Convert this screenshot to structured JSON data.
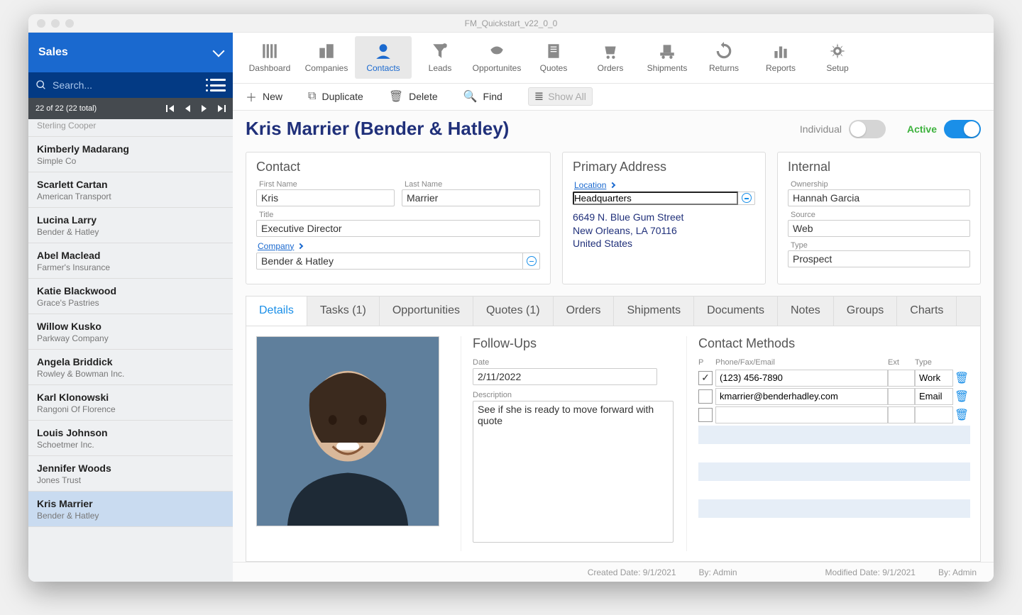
{
  "window": {
    "title": "FM_Quickstart_v22_0_0"
  },
  "sidebar": {
    "module": "Sales",
    "search_placeholder": "Search...",
    "pager": "22 of 22 (22 total)",
    "partial_item": {
      "company": "Sterling Cooper"
    },
    "items": [
      {
        "name": "Kimberly Madarang",
        "company": "Simple Co"
      },
      {
        "name": "Scarlett Cartan",
        "company": "American Transport"
      },
      {
        "name": "Lucina Larry",
        "company": "Bender & Hatley"
      },
      {
        "name": "Abel Maclead",
        "company": "Farmer's Insurance"
      },
      {
        "name": "Katie Blackwood",
        "company": "Grace's Pastries"
      },
      {
        "name": "Willow Kusko",
        "company": "Parkway Company"
      },
      {
        "name": "Angela Briddick",
        "company": "Rowley & Bowman Inc."
      },
      {
        "name": "Karl Klonowski",
        "company": "Rangoni Of Florence"
      },
      {
        "name": "Louis Johnson",
        "company": "Schoetmer Inc."
      },
      {
        "name": "Jennifer Woods",
        "company": "Jones Trust"
      },
      {
        "name": "Kris Marrier",
        "company": "Bender & Hatley"
      }
    ],
    "selected_index": 10
  },
  "toolbar": {
    "items": [
      "Dashboard",
      "Companies",
      "Contacts",
      "Leads",
      "Opportunites",
      "Quotes",
      "Orders",
      "Shipments",
      "Returns",
      "Reports",
      "Setup"
    ],
    "active_index": 2
  },
  "actions": {
    "new": "New",
    "duplicate": "Duplicate",
    "delete": "Delete",
    "find": "Find",
    "show_all": "Show All"
  },
  "record": {
    "title": "Kris Marrier (Bender & Hatley)",
    "individual_label": "Individual",
    "active_label": "Active"
  },
  "contact_panel": {
    "title": "Contact",
    "first_name_label": "First Name",
    "first_name": "Kris",
    "last_name_label": "Last Name",
    "last_name": "Marrier",
    "title_label": "Title",
    "title_value": "Executive Director",
    "company_label": "Company",
    "company": "Bender & Hatley"
  },
  "address_panel": {
    "title": "Primary Address",
    "location_label": "Location",
    "location": "Headquarters",
    "line1": "6649 N. Blue Gum Street",
    "line2": "New Orleans, LA 70116",
    "line3": "United States"
  },
  "internal_panel": {
    "title": "Internal",
    "ownership_label": "Ownership",
    "ownership": "Hannah Garcia",
    "source_label": "Source",
    "source": "Web",
    "type_label": "Type",
    "type": "Prospect"
  },
  "tabs": {
    "items": [
      "Details",
      "Tasks (1)",
      "Opportunities",
      "Quotes (1)",
      "Orders",
      "Shipments",
      "Documents",
      "Notes",
      "Groups",
      "Charts"
    ],
    "active_index": 0
  },
  "followups": {
    "title": "Follow-Ups",
    "date_label": "Date",
    "date": "2/11/2022",
    "desc_label": "Description",
    "desc": "See if she is ready to move forward with quote"
  },
  "methods": {
    "title": "Contact Methods",
    "head_p": "P",
    "head_main": "Phone/Fax/Email",
    "head_ext": "Ext",
    "head_type": "Type",
    "rows": [
      {
        "primary": true,
        "value": "(123) 456-7890",
        "ext": "",
        "type": "Work"
      },
      {
        "primary": false,
        "value": "kmarrier@benderhadley.com",
        "ext": "",
        "type": "Email"
      },
      {
        "primary": false,
        "value": "",
        "ext": "",
        "type": ""
      }
    ]
  },
  "footer": {
    "created_label": "Created Date:",
    "created_date": "9/1/2021",
    "created_by_label": "By:",
    "created_by": "Admin",
    "modified_label": "Modified Date:",
    "modified_date": "9/1/2021",
    "modified_by_label": "By:",
    "modified_by": "Admin"
  }
}
